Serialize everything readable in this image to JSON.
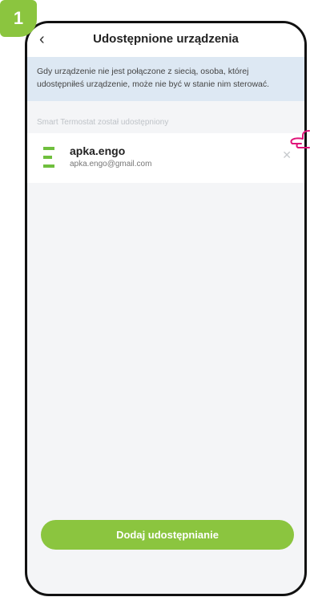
{
  "step": {
    "number": "1"
  },
  "header": {
    "back_icon": "chevron-left-icon",
    "title": "Udostępnione urządzenia"
  },
  "info": {
    "text": "Gdy urządzenie nie jest połączone z siecią, osoba, której udostępniłeś urządzenie, może nie być w stanie nim sterować."
  },
  "section": {
    "label": "Smart Termostat został udostępniony"
  },
  "shared_user": {
    "name": "apka.engo",
    "email": "apka.engo@gmail.com",
    "logo_icon": "engo-logo-icon",
    "remove_icon": "close-icon"
  },
  "actions": {
    "add_share_label": "Dodaj udostępnianie"
  },
  "colors": {
    "accent": "#8bc53f",
    "banner": "#dde8f3",
    "pointer": "#e0157a"
  }
}
